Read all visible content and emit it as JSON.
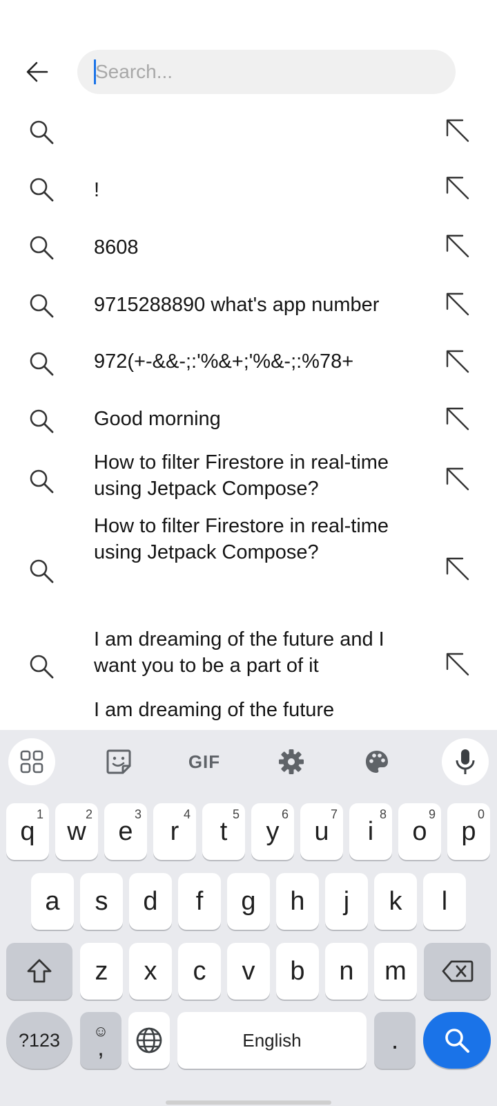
{
  "search": {
    "placeholder": "Search...",
    "value": ""
  },
  "suggestions": [
    {
      "text": ""
    },
    {
      "text": "!"
    },
    {
      "text": "8608"
    },
    {
      "text": "9715288890 what's app number"
    },
    {
      "text": "972(+-&&-;:'%&+;'%&-;:%78+"
    },
    {
      "text": "Good morning"
    },
    {
      "text": "How to filter Firestore in real-time using Jetpack Compose?"
    },
    {
      "text": "How to filter Firestore in real-time using Jetpack Compose?"
    },
    {
      "text": "I am dreaming of the future and I want you to be a part of it"
    },
    {
      "text": "I am dreaming of the future"
    }
  ],
  "toolbar": {
    "gif_label": "GIF",
    "icons": [
      "apps-grid-icon",
      "sticker-icon",
      "gif-icon",
      "settings-gear-icon",
      "palette-icon",
      "microphone-icon"
    ]
  },
  "keyboard": {
    "row1": [
      {
        "key": "q",
        "hint": "1"
      },
      {
        "key": "w",
        "hint": "2"
      },
      {
        "key": "e",
        "hint": "3"
      },
      {
        "key": "r",
        "hint": "4"
      },
      {
        "key": "t",
        "hint": "5"
      },
      {
        "key": "y",
        "hint": "6"
      },
      {
        "key": "u",
        "hint": "7"
      },
      {
        "key": "i",
        "hint": "8"
      },
      {
        "key": "o",
        "hint": "9"
      },
      {
        "key": "p",
        "hint": "0"
      }
    ],
    "row2": [
      "a",
      "s",
      "d",
      "f",
      "g",
      "h",
      "j",
      "k",
      "l"
    ],
    "row3": [
      "z",
      "x",
      "c",
      "v",
      "b",
      "n",
      "m"
    ],
    "symbols_label": "?123",
    "comma_emoji": "☺",
    "comma_label": ",",
    "space_label": "English",
    "period_label": "."
  },
  "colors": {
    "accent": "#1a73e8",
    "keyboard_bg": "#e9eaee",
    "search_bg": "#f0f0f0"
  }
}
